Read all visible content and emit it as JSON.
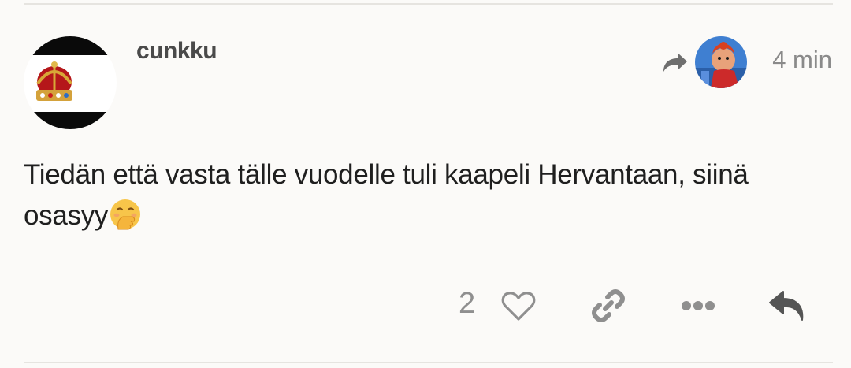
{
  "post": {
    "username": "cunkku",
    "time": "4 min",
    "body_line1": "Tiedän että vasta tälle vuodelle tuli kaapeli Hervantaan, siinä",
    "body_line2": "osasyy",
    "like_count": "2"
  },
  "icons": {
    "avatar": "crown-avatar",
    "reply_to_arrow": "share-arrow-icon",
    "reply_to_avatar": "reply-to-user-avatar",
    "emoji": "hand-over-mouth-emoji",
    "like": "heart-icon",
    "link": "link-icon",
    "more": "ellipsis-icon",
    "reply": "reply-icon"
  },
  "colors": {
    "background": "#fbfaf8",
    "divider": "#e6e4e0",
    "muted": "#8f8f8f",
    "username": "#4a4a4a",
    "reply_icon": "#555555"
  }
}
